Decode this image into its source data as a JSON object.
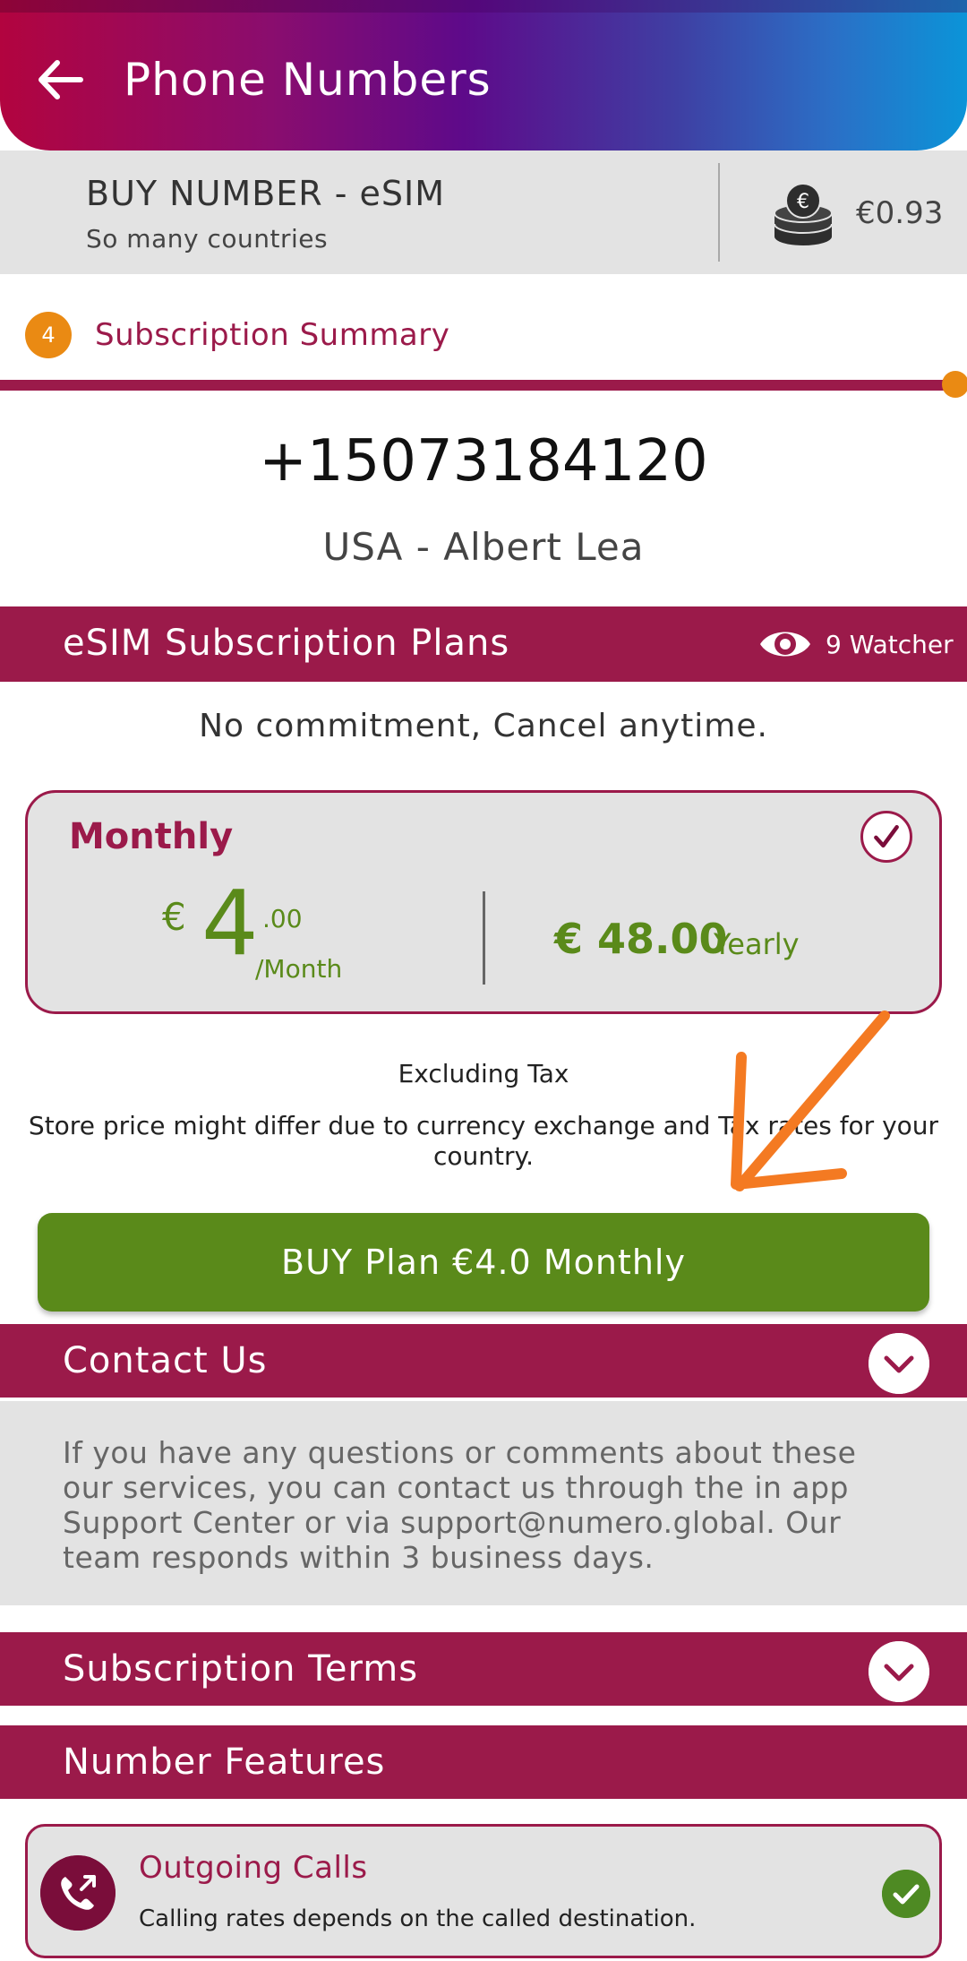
{
  "appbar": {
    "title": "Phone Numbers",
    "back_icon": "arrow-left-icon"
  },
  "header": {
    "title": "BUY NUMBER - eSIM",
    "subtitle": "So many countries",
    "balance": "€0.93",
    "balance_icon": "euro-coins-icon"
  },
  "step": {
    "number": "4",
    "title": "Subscription Summary"
  },
  "number": {
    "value": "+15073184120",
    "location": "USA - Albert Lea"
  },
  "plans": {
    "header": "eSIM Subscription Plans",
    "watchers": "9 Watcher",
    "commitment": "No commitment, Cancel anytime.",
    "selected": {
      "name": "Monthly",
      "currency": "€",
      "amount_int": "4",
      "amount_dec": ".00",
      "period": "/Month",
      "yearly_amount": "€ 48.00",
      "yearly_label": "Yearly"
    },
    "tax_note": "Excluding Tax",
    "store_note": "Store price might differ due to currency exchange and Tax rates for your country."
  },
  "buy_button": {
    "label": "BUY Plan €4.0 Monthly"
  },
  "contact": {
    "header": "Contact Us",
    "text": "If you have any questions or comments about these our services, you can contact us through the in app Support Center or via support@numero.global. Our team responds within 3 business days."
  },
  "terms": {
    "header": "Subscription Terms"
  },
  "features": {
    "header": "Number Features",
    "items": [
      {
        "title": "Outgoing Calls",
        "description": "Calling rates depends on the called destination."
      }
    ]
  },
  "colors": {
    "brand": "#9b1a4a",
    "accent": "#ea8a13",
    "price_green": "#5a8a1a",
    "annotation_arrow": "#f47a22"
  }
}
